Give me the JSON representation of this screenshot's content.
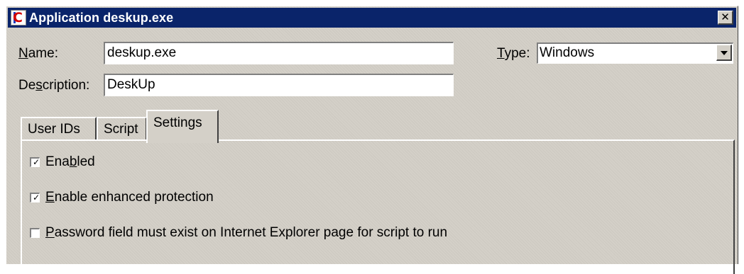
{
  "window": {
    "title": "Application deskup.exe",
    "icon": "app-c-icon",
    "close_glyph": "✕"
  },
  "form": {
    "name_label": {
      "pre": "",
      "accel": "N",
      "post": "ame:"
    },
    "name_value": "deskup.exe",
    "type_label": {
      "pre": "",
      "accel": "T",
      "post": "ype:"
    },
    "type_value": "Windows",
    "description_label": {
      "pre": "De",
      "accel": "s",
      "post": "cription:"
    },
    "description_value": "DeskUp"
  },
  "tabs": [
    {
      "label": "User IDs",
      "active": false
    },
    {
      "label": "Script",
      "active": false
    },
    {
      "label": "Settings",
      "active": true
    }
  ],
  "settings": {
    "enabled": {
      "checked": true,
      "pre": "Ena",
      "accel": "b",
      "post": "led"
    },
    "enhanced": {
      "checked": true,
      "pre": "",
      "accel": "E",
      "post": "nable enhanced protection"
    },
    "password": {
      "checked": false,
      "pre": "",
      "accel": "P",
      "post": "assword field must exist on Internet Explorer page for script to run"
    }
  },
  "check_glyph": "✓"
}
